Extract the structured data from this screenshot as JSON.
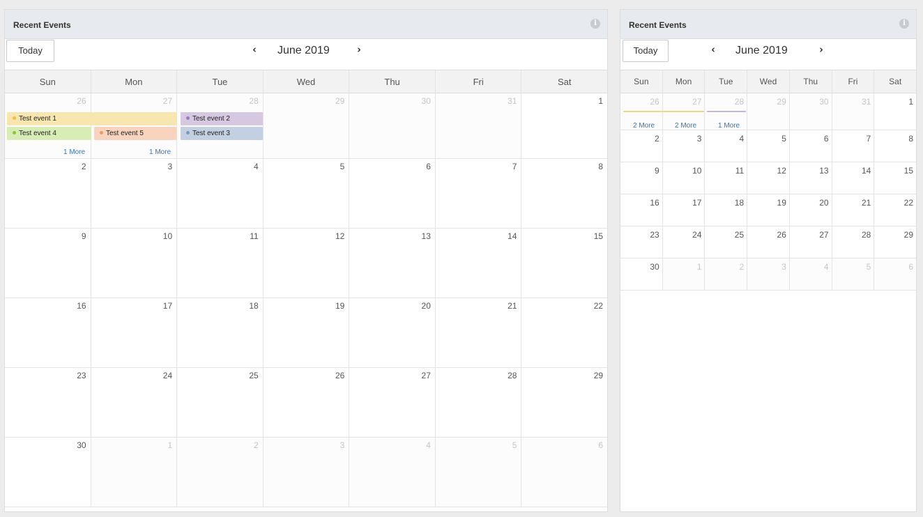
{
  "left_panel": {
    "title": "Recent Events",
    "today_label": "Today",
    "month_label": "June 2019",
    "prev_icon": "‹",
    "next_icon": "›",
    "weekdays": [
      "Sun",
      "Mon",
      "Tue",
      "Wed",
      "Thu",
      "Fri",
      "Sat"
    ],
    "weeks": [
      [
        {
          "d": "26",
          "other": true
        },
        {
          "d": "27",
          "other": true
        },
        {
          "d": "28",
          "other": true
        },
        {
          "d": "29",
          "other": true
        },
        {
          "d": "30",
          "other": true
        },
        {
          "d": "31",
          "other": true
        },
        {
          "d": "1",
          "other": false
        }
      ],
      [
        {
          "d": "2",
          "other": false
        },
        {
          "d": "3",
          "other": false
        },
        {
          "d": "4",
          "other": false
        },
        {
          "d": "5",
          "other": false
        },
        {
          "d": "6",
          "other": false
        },
        {
          "d": "7",
          "other": false
        },
        {
          "d": "8",
          "other": false
        }
      ],
      [
        {
          "d": "9",
          "other": false
        },
        {
          "d": "10",
          "other": false
        },
        {
          "d": "11",
          "other": false
        },
        {
          "d": "12",
          "other": false
        },
        {
          "d": "13",
          "other": false
        },
        {
          "d": "14",
          "other": false
        },
        {
          "d": "15",
          "other": false
        }
      ],
      [
        {
          "d": "16",
          "other": false
        },
        {
          "d": "17",
          "other": false
        },
        {
          "d": "18",
          "other": false
        },
        {
          "d": "19",
          "other": false
        },
        {
          "d": "20",
          "other": false
        },
        {
          "d": "21",
          "other": false
        },
        {
          "d": "22",
          "other": false
        }
      ],
      [
        {
          "d": "23",
          "other": false
        },
        {
          "d": "24",
          "other": false
        },
        {
          "d": "25",
          "other": false
        },
        {
          "d": "26",
          "other": false
        },
        {
          "d": "27",
          "other": false
        },
        {
          "d": "28",
          "other": false
        },
        {
          "d": "29",
          "other": false
        }
      ],
      [
        {
          "d": "30",
          "other": false
        },
        {
          "d": "1",
          "other": true
        },
        {
          "d": "2",
          "other": true
        },
        {
          "d": "3",
          "other": true
        },
        {
          "d": "4",
          "other": true
        },
        {
          "d": "5",
          "other": true
        },
        {
          "d": "6",
          "other": true
        }
      ]
    ],
    "events": [
      {
        "label": "Test event 1",
        "bg": "#f7e6b0",
        "dot": "#f0c040"
      },
      {
        "label": "Test event 2",
        "bg": "#d6c8e0",
        "dot": "#9a7ab8"
      },
      {
        "label": "Test event 4",
        "bg": "#d7edb5",
        "dot": "#8cc63e"
      },
      {
        "label": "Test event 5",
        "bg": "#f8d3bd",
        "dot": "#ef9a60"
      },
      {
        "label": "Test event 3",
        "bg": "#c2d0e2",
        "dot": "#7a98c4"
      }
    ],
    "more_links": [
      "1 More",
      "1 More"
    ]
  },
  "right_panel": {
    "title": "Recent Events",
    "today_label": "Today",
    "month_label": "June 2019",
    "prev_icon": "‹",
    "next_icon": "›",
    "weekdays": [
      "Sun",
      "Mon",
      "Tue",
      "Wed",
      "Thu",
      "Fri",
      "Sat"
    ],
    "weeks": [
      [
        {
          "d": "26",
          "other": true
        },
        {
          "d": "27",
          "other": true
        },
        {
          "d": "28",
          "other": true
        },
        {
          "d": "29",
          "other": true
        },
        {
          "d": "30",
          "other": true
        },
        {
          "d": "31",
          "other": true
        },
        {
          "d": "1",
          "other": false
        }
      ],
      [
        {
          "d": "2",
          "other": false
        },
        {
          "d": "3",
          "other": false
        },
        {
          "d": "4",
          "other": false
        },
        {
          "d": "5",
          "other": false
        },
        {
          "d": "6",
          "other": false
        },
        {
          "d": "7",
          "other": false
        },
        {
          "d": "8",
          "other": false
        }
      ],
      [
        {
          "d": "9",
          "other": false
        },
        {
          "d": "10",
          "other": false
        },
        {
          "d": "11",
          "other": false
        },
        {
          "d": "12",
          "other": false
        },
        {
          "d": "13",
          "other": false
        },
        {
          "d": "14",
          "other": false
        },
        {
          "d": "15",
          "other": false
        }
      ],
      [
        {
          "d": "16",
          "other": false
        },
        {
          "d": "17",
          "other": false
        },
        {
          "d": "18",
          "other": false
        },
        {
          "d": "19",
          "other": false
        },
        {
          "d": "20",
          "other": false
        },
        {
          "d": "21",
          "other": false
        },
        {
          "d": "22",
          "other": false
        }
      ],
      [
        {
          "d": "23",
          "other": false
        },
        {
          "d": "24",
          "other": false
        },
        {
          "d": "25",
          "other": false
        },
        {
          "d": "26",
          "other": false
        },
        {
          "d": "27",
          "other": false
        },
        {
          "d": "28",
          "other": false
        },
        {
          "d": "29",
          "other": false
        }
      ],
      [
        {
          "d": "30",
          "other": false
        },
        {
          "d": "1",
          "other": true
        },
        {
          "d": "2",
          "other": true
        },
        {
          "d": "3",
          "other": true
        },
        {
          "d": "4",
          "other": true
        },
        {
          "d": "5",
          "other": true
        },
        {
          "d": "6",
          "other": true
        }
      ]
    ],
    "more_links": [
      "2 More",
      "2 More",
      "1 More"
    ],
    "bar_colors": [
      "#f0d490",
      "#c8b4de"
    ]
  },
  "icons": {
    "info": "i"
  }
}
